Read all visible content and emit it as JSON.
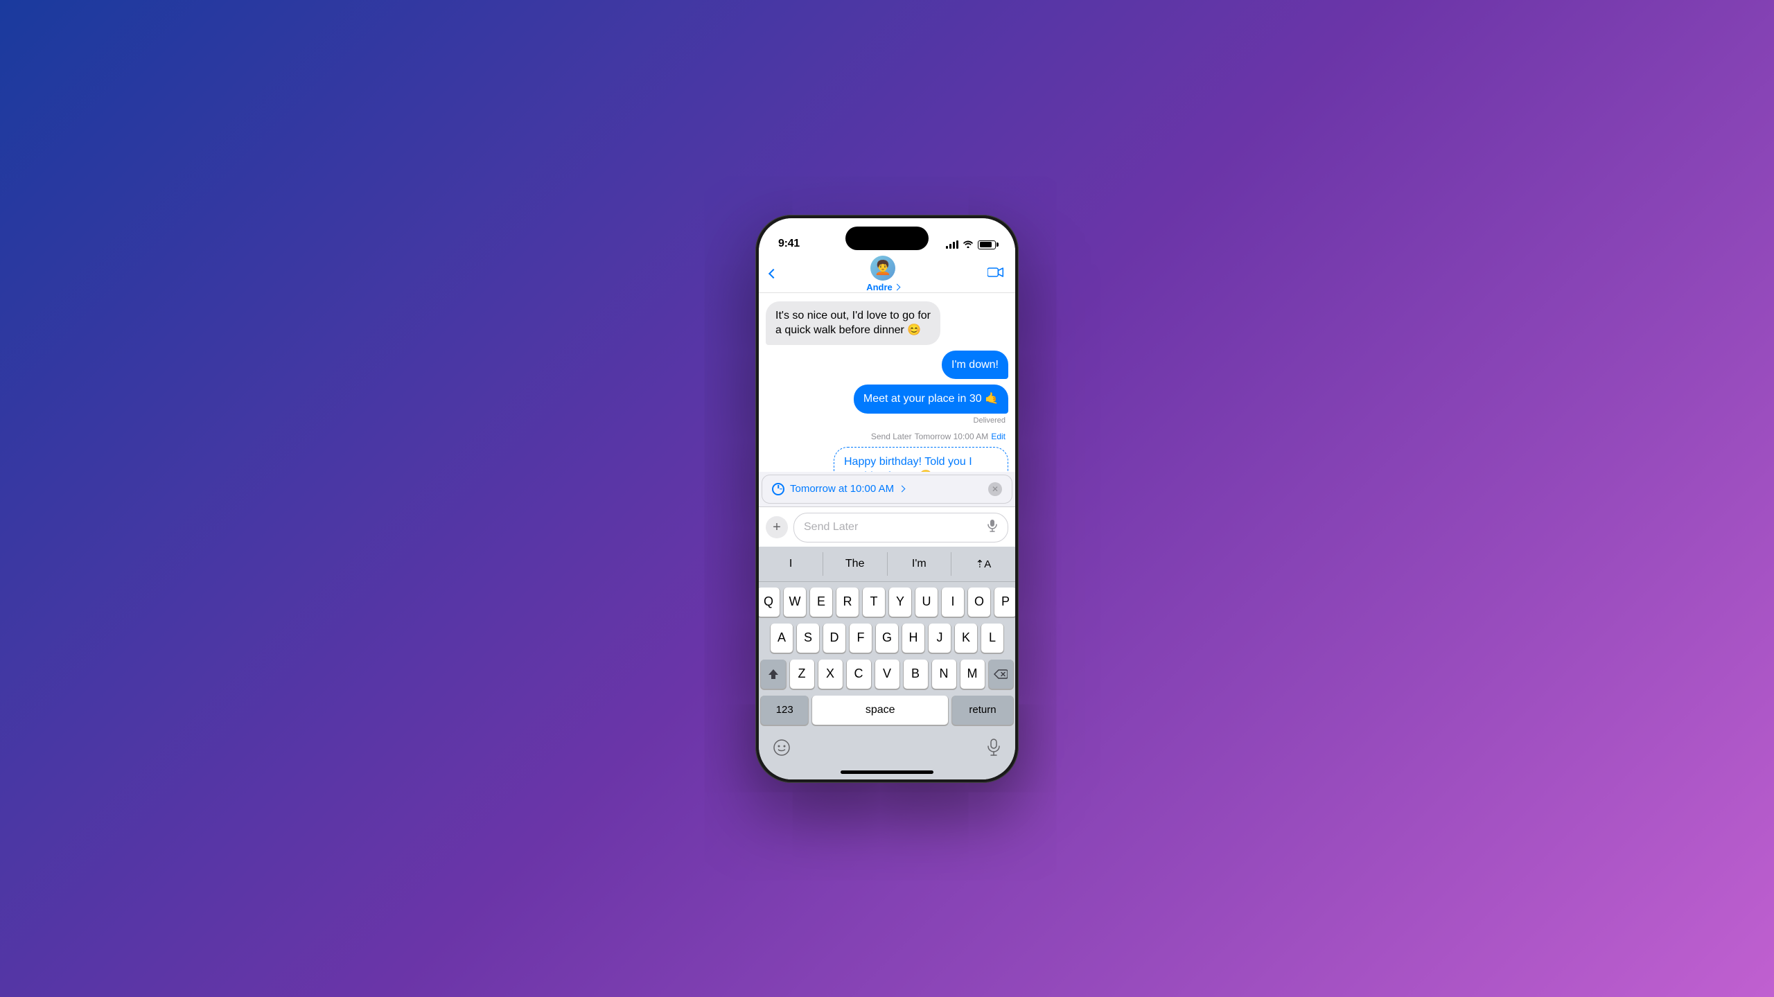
{
  "status": {
    "time": "9:41",
    "battery_level": "85%"
  },
  "nav": {
    "back_label": "",
    "contact_name": "Andre",
    "contact_chevron": "›",
    "avatar_emoji": "🧑"
  },
  "messages": [
    {
      "id": "msg1",
      "type": "received",
      "text": "It's so nice out, I'd love to go for a quick walk before dinner 😊"
    },
    {
      "id": "msg2",
      "type": "sent",
      "text": "I'm down!"
    },
    {
      "id": "msg3",
      "type": "sent",
      "text": "Meet at your place in 30 🤙"
    },
    {
      "id": "msg3_delivered",
      "type": "meta",
      "text": "Delivered"
    },
    {
      "id": "msg4_meta",
      "type": "send_later_label",
      "label": "Send Later",
      "time": "Tomorrow 10:00 AM",
      "edit": "Edit"
    },
    {
      "id": "msg4",
      "type": "sent_later",
      "text": "Happy birthday! Told you I wouldn't forget 😏"
    }
  ],
  "schedule_banner": {
    "label": "Tomorrow at 10:00 AM",
    "chevron": "›"
  },
  "input": {
    "placeholder": "Send Later"
  },
  "keyboard": {
    "suggestions": [
      "I",
      "The",
      "I'm",
      "⇡A"
    ],
    "rows": [
      [
        "Q",
        "W",
        "E",
        "R",
        "T",
        "Y",
        "U",
        "I",
        "O",
        "P"
      ],
      [
        "A",
        "S",
        "D",
        "F",
        "G",
        "H",
        "J",
        "K",
        "L"
      ],
      [
        "⇧",
        "Z",
        "X",
        "C",
        "V",
        "B",
        "N",
        "M",
        "⌫"
      ],
      [
        "123",
        "space",
        "return"
      ]
    ],
    "bottom": {
      "emoji": "☺",
      "mic": "🎤"
    }
  }
}
